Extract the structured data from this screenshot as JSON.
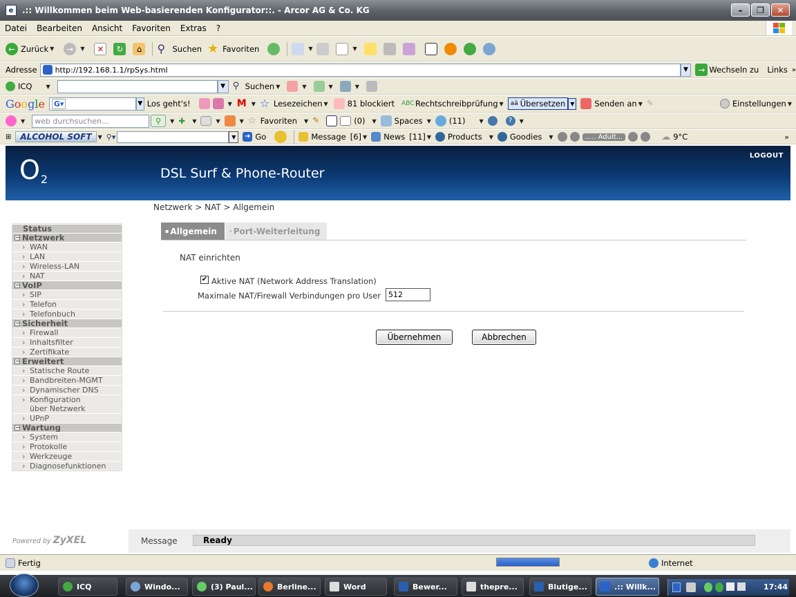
{
  "window": {
    "title": ".:: Willkommen beim Web-basierenden Konfigurator::. - Arcor AG & Co. KG"
  },
  "menu": [
    "Datei",
    "Bearbeiten",
    "Ansicht",
    "Favoriten",
    "Extras",
    "?"
  ],
  "toolbar": {
    "back": "Zurück",
    "search": "Suchen",
    "favorites": "Favoriten"
  },
  "address": {
    "label": "Adresse",
    "url": "http://192.168.1.1/rpSys.html",
    "go": "Wechseln zu",
    "links": "Links"
  },
  "icq_bar": {
    "label": "ICQ",
    "search": "Suchen"
  },
  "google_bar": {
    "brand": "Google",
    "go": "Los geht's!",
    "bookmarks": "Lesezeichen",
    "blocked": "81 blockiert",
    "spell": "Rechtschreibprüfung",
    "translate": "Übersetzen",
    "send": "Senden an",
    "settings": "Einstellungen"
  },
  "web_bar": {
    "search_placeholder": "web durchsuchen...",
    "favorites": "Favoriten",
    "mail_count": "(0)",
    "spaces": "Spaces",
    "contacts": "(11)"
  },
  "alcohol_bar": {
    "brand": "ALCOHOL SOFT",
    "go": "Go",
    "message": "Message",
    "message_count": "[6]",
    "news": "News",
    "news_count": "[11]",
    "products": "Products",
    "goodies": "Goodies",
    "player": "..... Adult...",
    "weather": "9°C"
  },
  "router": {
    "brand": "O",
    "brand_sub": "2",
    "product": "DSL Surf & Phone-Router",
    "logout": "LOGOUT",
    "breadcrumb": "Netzwerk > NAT > Allgemein",
    "sidebar": [
      {
        "label": "Status",
        "items": []
      },
      {
        "label": "Netzwerk",
        "items": [
          "WAN",
          "LAN",
          "Wireless-LAN",
          "NAT"
        ]
      },
      {
        "label": "VoIP",
        "items": [
          "SIP",
          "Telefon",
          "Telefonbuch"
        ]
      },
      {
        "label": "Sicherheit",
        "items": [
          "Firewall",
          "Inhaltsfilter",
          "Zertifikate"
        ]
      },
      {
        "label": "Erweitert",
        "items": [
          "Statische Route",
          "Bandbreiten-MGMT",
          "Dynamischer DNS",
          "Konfiguration über Netzwerk",
          "UPnP"
        ]
      },
      {
        "label": "Wartung",
        "items": [
          "System",
          "Protokolle",
          "Werkzeuge",
          "Diagnosefunktionen"
        ]
      }
    ],
    "tabs": [
      "Allgemein",
      "Port-Weiterleitung"
    ],
    "section_title": "NAT einrichten",
    "nat_checkbox_label": "Aktive NAT (Network Address Translation)",
    "nat_checked": true,
    "max_label": "Maximale NAT/Firewall Verbindungen pro User",
    "max_value": "512",
    "apply": "Übernehmen",
    "cancel": "Abbrechen",
    "powered_prefix": "Powered by",
    "powered_brand": "ZyXEL",
    "message_label": "Message",
    "message_value": "Ready"
  },
  "statusbar": {
    "left": "Fertig",
    "zone": "Internet"
  },
  "taskbar": {
    "items": [
      "ICQ",
      "Windo...",
      "(3) Paul...",
      "Berline...",
      "Word",
      "Bewer...",
      "thepre...",
      "Blutige...",
      ".:: Willk..."
    ],
    "clock": "17:44"
  },
  "colors": {
    "header_blue": "#0b3a74",
    "tab_active": "#8c8c8c",
    "sidebar_section": "#c7c6c2"
  }
}
